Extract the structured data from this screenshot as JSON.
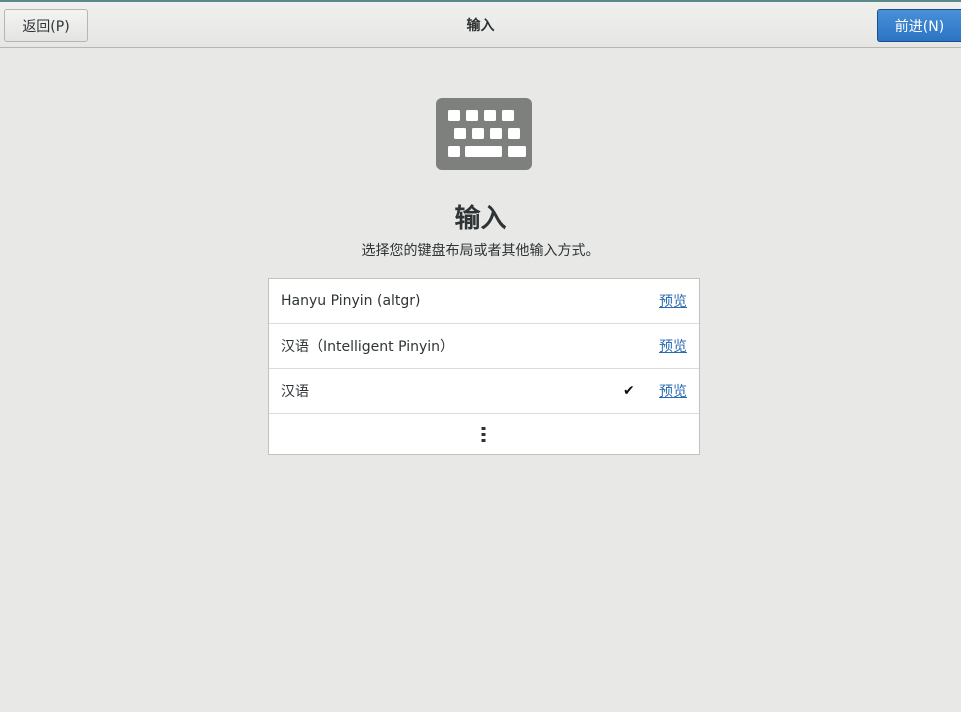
{
  "header": {
    "back_label": "返回(P)",
    "title": "输入",
    "next_label": "前进(N)"
  },
  "main": {
    "icon": "keyboard-icon",
    "heading": "输入",
    "subtitle": "选择您的键盘布局或者其他输入方式。"
  },
  "input_sources": [
    {
      "label": "Hanyu Pinyin (altgr)",
      "selected": false,
      "preview_label": "预览"
    },
    {
      "label": "汉语（Intelligent Pinyin）",
      "selected": false,
      "preview_label": "预览"
    },
    {
      "label": "汉语",
      "selected": true,
      "check": "✔",
      "preview_label": "预览"
    }
  ],
  "more": {
    "icon": "more-vertical-icon"
  },
  "colors": {
    "accent": "#2a74c2",
    "link": "#2a6bb0",
    "background": "#e8e8e7"
  }
}
